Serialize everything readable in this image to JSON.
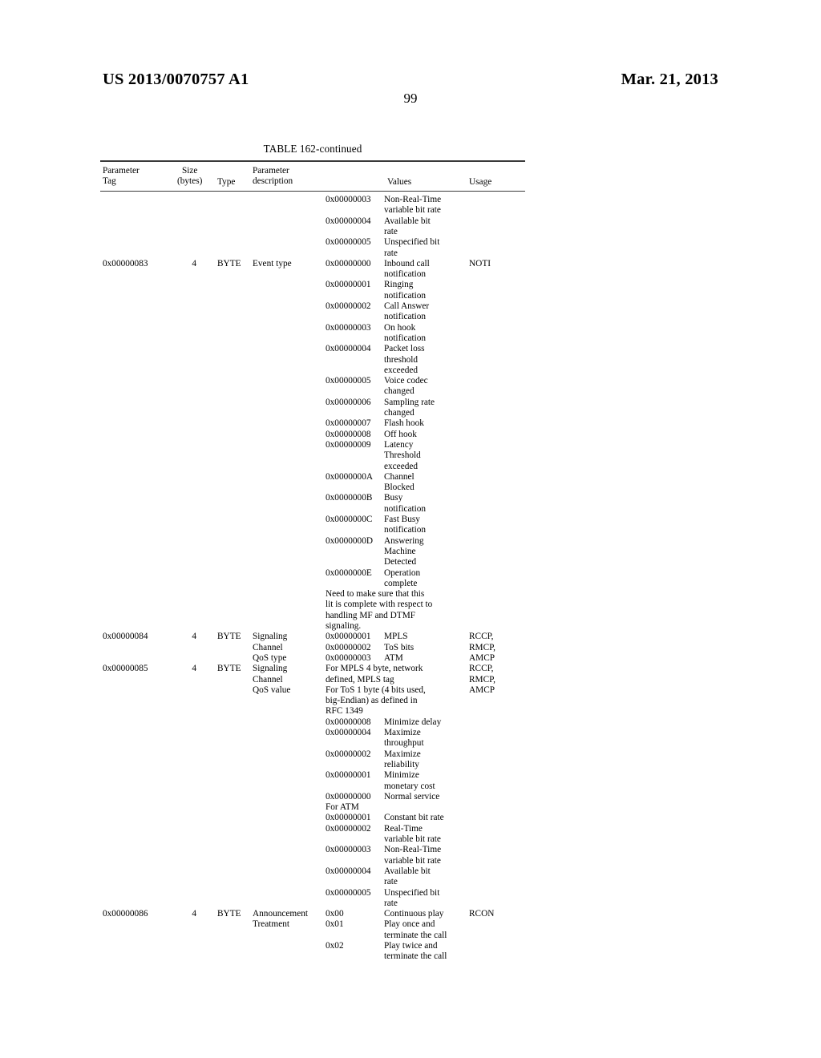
{
  "header": {
    "publication_number": "US 2013/0070757 A1",
    "publication_date": "Mar. 21, 2013",
    "page_number": "99"
  },
  "table": {
    "caption": "TABLE 162-continued",
    "columns": {
      "parameter_tag": "Parameter\nTag",
      "size_bytes": "Size\n(bytes)",
      "type": "Type",
      "parameter_description": "Parameter\ndescription",
      "values": "Values",
      "usage": "Usage"
    },
    "continued_values": [
      {
        "code": "0x00000003",
        "lines": [
          "Non-Real-Time",
          "variable bit rate"
        ]
      },
      {
        "code": "0x00000004",
        "lines": [
          "Available bit",
          "rate"
        ]
      },
      {
        "code": "0x00000005",
        "lines": [
          "Unspecified bit",
          "rate"
        ]
      }
    ],
    "rows": [
      {
        "tag": "0x00000083",
        "size": "4",
        "type": "BYTE",
        "description": [
          "Event type"
        ],
        "usage": [
          "NOTI"
        ],
        "values": [
          {
            "code": "0x00000000",
            "lines": [
              "Inbound call",
              "notification"
            ]
          },
          {
            "code": "0x00000001",
            "lines": [
              "Ringing",
              "notification"
            ]
          },
          {
            "code": "0x00000002",
            "lines": [
              "Call Answer",
              "notification"
            ]
          },
          {
            "code": "0x00000003",
            "lines": [
              "On hook",
              "notification"
            ]
          },
          {
            "code": "0x00000004",
            "lines": [
              "Packet loss",
              "threshold",
              "exceeded"
            ]
          },
          {
            "code": "0x00000005",
            "lines": [
              "Voice codec",
              "changed"
            ]
          },
          {
            "code": "0x00000006",
            "lines": [
              "Sampling rate",
              "changed"
            ]
          },
          {
            "code": "0x00000007",
            "lines": [
              "Flash hook"
            ]
          },
          {
            "code": "0x00000008",
            "lines": [
              "Off hook"
            ]
          },
          {
            "code": "0x00000009",
            "lines": [
              "Latency",
              "Threshold",
              "exceeded"
            ]
          },
          {
            "code": "0x0000000A",
            "lines": [
              "Channel",
              "Blocked"
            ]
          },
          {
            "code": "0x0000000B",
            "lines": [
              "Busy",
              "notification"
            ]
          },
          {
            "code": "0x0000000C",
            "lines": [
              "Fast Busy",
              "notification"
            ]
          },
          {
            "code": "0x0000000D",
            "lines": [
              "Answering",
              "Machine",
              "Detected"
            ]
          },
          {
            "code": "0x0000000E",
            "lines": [
              "Operation",
              "complete"
            ]
          }
        ],
        "note": [
          "Need to make sure that this",
          "lit is complete with respect to",
          "handling MF and DTMF",
          "signaling."
        ]
      },
      {
        "tag": "0x00000084",
        "size": "4",
        "type": "BYTE",
        "description": [
          "Signaling",
          "Channel",
          "QoS type"
        ],
        "usage": [
          "RCCP,",
          "RMCP,",
          "AMCP"
        ],
        "values": [
          {
            "code": "0x00000001",
            "lines": [
              "MPLS"
            ]
          },
          {
            "code": "0x00000002",
            "lines": [
              "ToS bits"
            ]
          },
          {
            "code": "0x00000003",
            "lines": [
              "ATM"
            ]
          }
        ],
        "note": []
      },
      {
        "tag": "0x00000085",
        "size": "4",
        "type": "BYTE",
        "description": [
          "Signaling",
          "Channel",
          "QoS value"
        ],
        "usage": [
          "RCCP,",
          "RMCP,",
          "AMCP"
        ],
        "preamble": [
          "For MPLS 4 byte, network",
          "defined, MPLS tag",
          "For ToS 1 byte (4 bits used,",
          "big-Endian) as defined in",
          "RFC 1349"
        ],
        "values": [
          {
            "code": "0x00000008",
            "lines": [
              "Minimize delay"
            ]
          },
          {
            "code": "0x00000004",
            "lines": [
              "Maximize",
              "throughput"
            ]
          },
          {
            "code": "0x00000002",
            "lines": [
              "Maximize",
              "reliability"
            ]
          },
          {
            "code": "0x00000001",
            "lines": [
              "Minimize",
              "monetary cost"
            ]
          },
          {
            "code": "0x00000000",
            "lines": [
              "Normal service"
            ]
          }
        ],
        "midnote": [
          "For ATM"
        ],
        "values2": [
          {
            "code": "0x00000001",
            "lines": [
              "Constant bit rate"
            ]
          },
          {
            "code": "0x00000002",
            "lines": [
              "Real-Time",
              "variable bit rate"
            ]
          },
          {
            "code": "0x00000003",
            "lines": [
              "Non-Real-Time",
              "variable bit rate"
            ]
          },
          {
            "code": "0x00000004",
            "lines": [
              "Available bit",
              "rate"
            ]
          },
          {
            "code": "0x00000005",
            "lines": [
              "Unspecified bit",
              "rate"
            ]
          }
        ]
      },
      {
        "tag": "0x00000086",
        "size": "4",
        "type": "BYTE",
        "description": [
          "Announcement",
          "Treatment"
        ],
        "usage": [
          "RCON"
        ],
        "values": [
          {
            "code": "0x00",
            "lines": [
              "Continuous play"
            ]
          },
          {
            "code": "0x01",
            "lines": [
              "Play once and",
              "terminate the call"
            ]
          },
          {
            "code": "0x02",
            "lines": [
              "Play twice and",
              "terminate the call"
            ]
          }
        ],
        "note": []
      }
    ]
  }
}
